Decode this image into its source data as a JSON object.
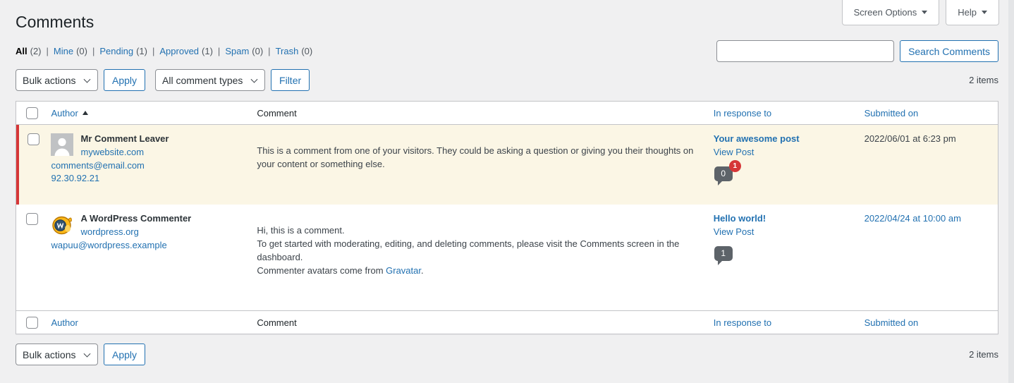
{
  "screen_meta": {
    "screen_options_label": "Screen Options",
    "help_label": "Help"
  },
  "page": {
    "title": "Comments",
    "items_count_top": "2 items",
    "items_count_bottom": "2 items"
  },
  "filters": {
    "links": [
      {
        "label": "All",
        "count": "(2)",
        "current": true
      },
      {
        "label": "Mine",
        "count": "(0)",
        "current": false
      },
      {
        "label": "Pending",
        "count": "(1)",
        "current": false
      },
      {
        "label": "Approved",
        "count": "(1)",
        "current": false
      },
      {
        "label": "Spam",
        "count": "(0)",
        "current": false
      },
      {
        "label": "Trash",
        "count": "(0)",
        "current": false
      }
    ]
  },
  "search": {
    "input_value": "",
    "button_label": "Search Comments"
  },
  "bulk": {
    "bulk_actions_label": "Bulk actions",
    "apply_label": "Apply",
    "comment_types_label": "All comment types",
    "filter_label": "Filter"
  },
  "table": {
    "headers": {
      "author": "Author",
      "comment": "Comment",
      "in_response_to": "In response to",
      "submitted_on": "Submitted on"
    },
    "rows": [
      {
        "status": "pending",
        "author": {
          "name": "Mr Comment Leaver",
          "url": "mywebsite.com",
          "email": "comments@email.com",
          "ip": "92.30.92.21"
        },
        "comment": "This is a comment from one of your visitors. They could be asking a question or giving you their thoughts on your content or something else.",
        "in_response_to": {
          "post": "Your awesome post",
          "view_label": "View Post",
          "approved_count": "0",
          "pending_count": "1"
        },
        "submitted": "2022/06/01 at 6:23 pm"
      },
      {
        "status": "approved",
        "author": {
          "name": "A WordPress Commenter",
          "url": "wordpress.org",
          "email": "wapuu@wordpress.example"
        },
        "comment_line1": "Hi, this is a comment.",
        "comment_line2": "To get started with moderating, editing, and deleting comments, please visit the Comments screen in the dashboard.",
        "comment_line3_prefix": "Commenter avatars come from ",
        "comment_line3_link": "Gravatar",
        "comment_line3_suffix": ".",
        "in_response_to": {
          "post": "Hello world!",
          "view_label": "View Post",
          "approved_count": "1"
        },
        "submitted": "2022/04/24 at 10:00 am"
      }
    ]
  },
  "colors": {
    "accent_blue": "#2271b1",
    "alert_red": "#d63638",
    "pending_row_bg": "#fbf6e5",
    "bubble_gray": "#5d6369",
    "page_bg": "#f0f0f1"
  }
}
